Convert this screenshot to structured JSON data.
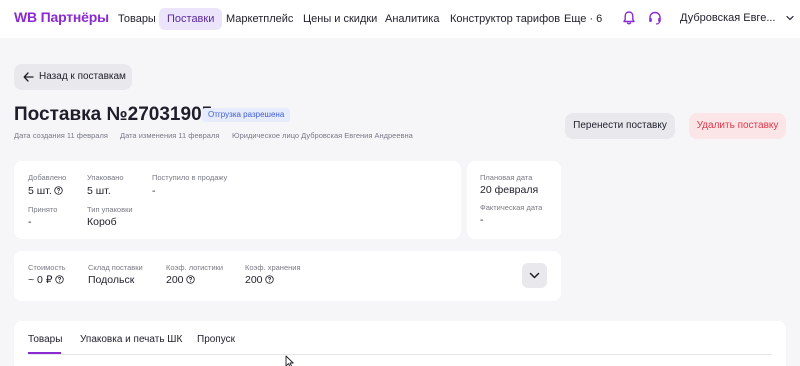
{
  "header": {
    "logo": "WB Партнёры",
    "nav": [
      {
        "label": "Товары"
      },
      {
        "label": "Поставки"
      },
      {
        "label": "Маркетплейс"
      },
      {
        "label": "Цены и скидки"
      },
      {
        "label": "Аналитика"
      },
      {
        "label": "Конструктор тарифов"
      },
      {
        "label": "Еще · 6"
      }
    ],
    "active_nav": "Поставки",
    "user_name": "Дубровская Евге..."
  },
  "back_button": "Назад к поставкам",
  "supply": {
    "title": "Поставка №27031905",
    "status": "Отгрузка разрешена",
    "created": "Дата создания 11 февраля",
    "modified": "Дата изменения 11 февраля",
    "legal_entity": "Юридическое лицо Дубровская Евгения Андреевна"
  },
  "actions": {
    "move": "Перенести поставку",
    "delete": "Удалить поставку"
  },
  "details": {
    "added_label": "Добавлено",
    "added_value": "5 шт.",
    "packed_label": "Упаковано",
    "packed_value": "5 шт.",
    "on_sale_label": "Поступило в продажу",
    "on_sale_value": "-",
    "accepted_label": "Принято",
    "accepted_value": "-",
    "pack_type_label": "Тип упаковки",
    "pack_type_value": "Короб"
  },
  "dates": {
    "planned_label": "Плановая дата",
    "planned_value": "20 февраля",
    "actual_label": "Фактическая дата",
    "actual_value": "-"
  },
  "costs": {
    "cost_label": "Стоимость",
    "cost_value": "~ 0 ₽",
    "warehouse_label": "Склад поставки",
    "warehouse_value": "Подольск",
    "logistics_label": "Коэф. логистики",
    "logistics_value": "200",
    "storage_label": "Коэф. хранения",
    "storage_value": "200"
  },
  "tabs": [
    {
      "label": "Товары"
    },
    {
      "label": "Упаковка и печать ШК"
    },
    {
      "label": "Пропуск"
    }
  ],
  "colors": {
    "brand": "#8a2bd1",
    "status_bg": "#e7ecfc",
    "status_text": "#3f5ed7",
    "danger": "#e0384a",
    "danger_bg": "#fbe5e7"
  },
  "icons": [
    "bell-icon",
    "headset-icon",
    "chevron-down-icon",
    "arrow-left-icon",
    "question-icon",
    "cursor-icon"
  ]
}
